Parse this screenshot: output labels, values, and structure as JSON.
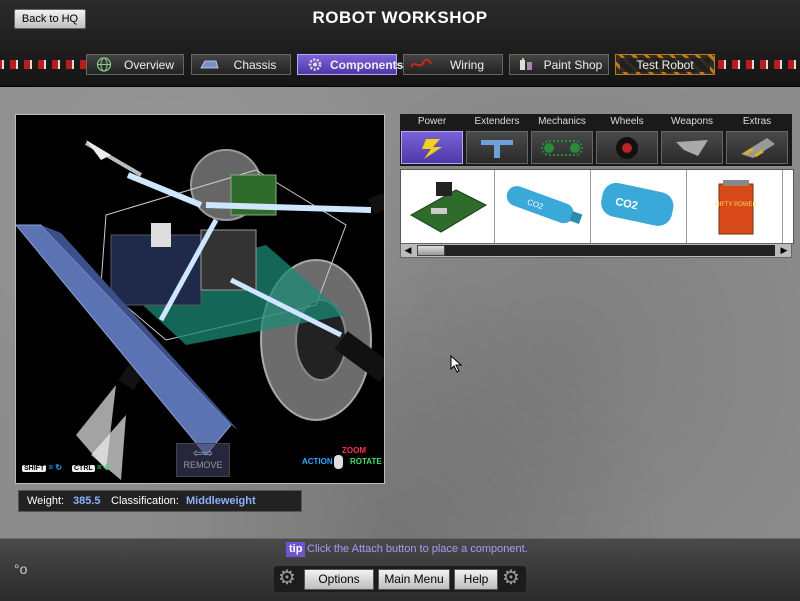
{
  "header": {
    "title": "ROBOT WORKSHOP",
    "back_label": "Back to HQ"
  },
  "tabs": [
    {
      "label": "Overview",
      "icon": "globe-icon",
      "active": false
    },
    {
      "label": "Chassis",
      "icon": "chassis-icon",
      "active": false
    },
    {
      "label": "Components",
      "icon": "gear-icon",
      "active": true
    },
    {
      "label": "Wiring",
      "icon": "wire-icon",
      "active": false
    },
    {
      "label": "Paint Shop",
      "icon": "paint-icon",
      "active": false
    },
    {
      "label": "Test Robot",
      "icon": "hazard-stripe",
      "active": false
    }
  ],
  "viewport": {
    "remove_label": "REMOVE",
    "shift_key": "SHIFT",
    "ctrl_key": "CTRL",
    "action_label": "ACTION",
    "zoom_label": "ZOOM",
    "rotate_label": "ROTATE"
  },
  "stats": {
    "weight_label": "Weight:",
    "weight_value": "385.5",
    "class_label": "Classification:",
    "class_value": "Middleweight"
  },
  "categories": [
    {
      "label": "Power",
      "icon": "lightning-icon",
      "active": true
    },
    {
      "label": "Extenders",
      "icon": "t-bar-icon",
      "active": false
    },
    {
      "label": "Mechanics",
      "icon": "chain-drive-icon",
      "active": false
    },
    {
      "label": "Wheels",
      "icon": "wheel-icon",
      "active": false
    },
    {
      "label": "Weapons",
      "icon": "blade-icon",
      "active": false
    },
    {
      "label": "Extras",
      "icon": "scoop-icon",
      "active": false
    }
  ],
  "parts": [
    {
      "icon": "circuit-board-icon"
    },
    {
      "icon": "blue-tank-icon",
      "tank_text": "CO2"
    },
    {
      "icon": "co2-tank-icon",
      "tank_text": "CO2"
    },
    {
      "icon": "nifty-battery-icon",
      "box_text": "NIFTY POWER"
    }
  ],
  "footer": {
    "tip_badge": "tip",
    "tip_text": "Click the Attach button to place a component.",
    "options_label": "Options",
    "main_menu_label": "Main Menu",
    "help_label": "Help"
  },
  "colors": {
    "accent": "#6f55d0",
    "value_text": "#8db0ff",
    "zoom": "#ff3355",
    "rotate": "#44e066",
    "action": "#33a7ff"
  }
}
